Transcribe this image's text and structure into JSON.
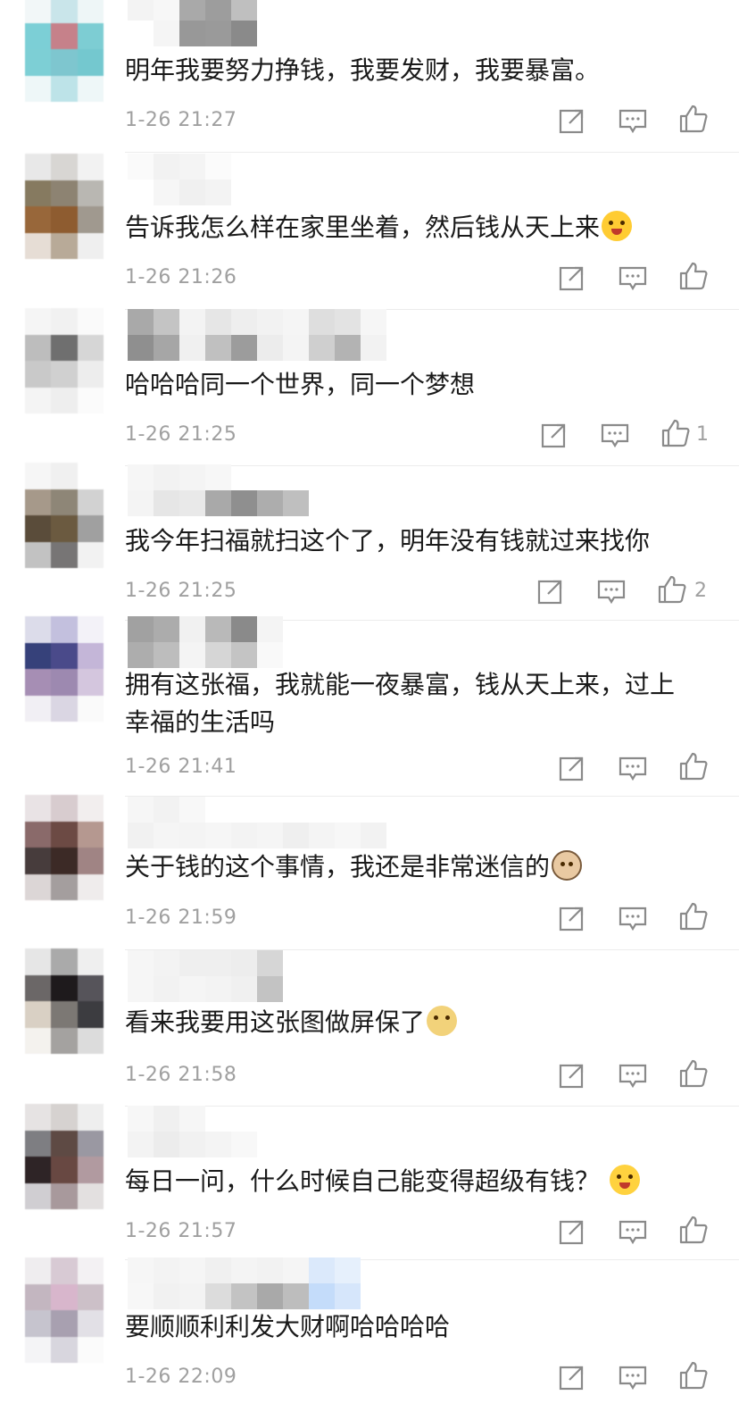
{
  "comments": [
    {
      "text": "明年我要努力挣钱，我要发财，我要暴富。",
      "time": "1-26 21:27",
      "likes": ""
    },
    {
      "text": "告诉我怎么样在家里坐着，然后钱从天上来",
      "time": "1-26 21:26",
      "likes": "",
      "emoji": "tongue-face-emoji"
    },
    {
      "text": "哈哈哈同一个世界，同一个梦想",
      "time": "1-26 21:25",
      "likes": "1"
    },
    {
      "text": "我今年扫福就扫这个了，明年没有钱就过来找你",
      "time": "1-26 21:25",
      "likes": "2"
    },
    {
      "text": "拥有这张福，我就能一夜暴富，钱从天上来，过上幸福的生活吗",
      "time": "1-26 21:41",
      "likes": ""
    },
    {
      "text": "关于钱的这个事情，我还是非常迷信的",
      "time": "1-26 21:59",
      "likes": "",
      "emoji": "cat-face-emoji"
    },
    {
      "text": "看来我要用这张图做屏保了",
      "time": "1-26 21:58",
      "likes": "",
      "emoji": "doge-emoji"
    },
    {
      "text": "每日一问，什么时候自己能变得超级有钱？",
      "time": "1-26 21:57",
      "likes": "",
      "emoji": "laughing-crying-emoji"
    },
    {
      "text": "要顺顺利利发大财啊哈哈哈哈",
      "time": "1-26 22:09",
      "likes": ""
    }
  ],
  "icons": {
    "share": "share-icon",
    "reply": "comment-icon",
    "like": "thumbs-up-icon"
  }
}
